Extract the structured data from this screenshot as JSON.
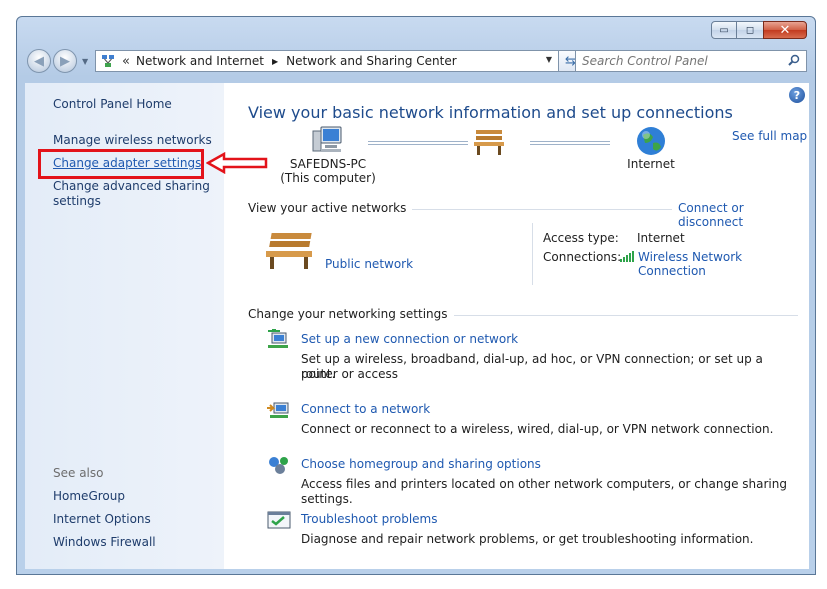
{
  "window": {
    "caption_buttons": {
      "minimize": "▭",
      "maximize": "◻",
      "close": "✕"
    }
  },
  "nav": {
    "breadcrumb": [
      "Network and Internet",
      "Network and Sharing Center"
    ],
    "overflow": "«",
    "search_placeholder": "Search Control Panel"
  },
  "sidebar": {
    "home": "Control Panel Home",
    "links": [
      "Manage wireless networks",
      "Change adapter settings",
      "Change advanced sharing",
      "settings"
    ],
    "see_also_label": "See also",
    "see_also": [
      "HomeGroup",
      "Internet Options",
      "Windows Firewall"
    ]
  },
  "main": {
    "title": "View your basic network information and set up connections",
    "see_full_map": "See full map",
    "map": {
      "computer_name": "SAFEDNS-PC",
      "computer_sub": "(This computer)",
      "internet": "Internet"
    },
    "active_networks": {
      "title": "View your active networks",
      "connect_link": "Connect or disconnect",
      "network_name": "Public network",
      "access_type_label": "Access type:",
      "access_type_value": "Internet",
      "connections_label": "Connections:",
      "connections_value": "Wireless Network Connection"
    },
    "settings": {
      "title": "Change your networking settings",
      "tasks": [
        {
          "title": "Set up a new connection or network",
          "desc1": "Set up a wireless, broadband, dial-up, ad hoc, or VPN connection; or set up a router or access",
          "desc2": "point."
        },
        {
          "title": "Connect to a network",
          "desc1": "Connect or reconnect to a wireless, wired, dial-up, or VPN network connection."
        },
        {
          "title": "Choose homegroup and sharing options",
          "desc1": "Access files and printers located on other network computers, or change sharing settings."
        },
        {
          "title": "Troubleshoot problems",
          "desc1": "Diagnose and repair network problems, or get troubleshooting information."
        }
      ]
    }
  },
  "colors": {
    "link": "#1f59b0",
    "highlight": "#e3131a",
    "heading": "#1e4b8c"
  }
}
